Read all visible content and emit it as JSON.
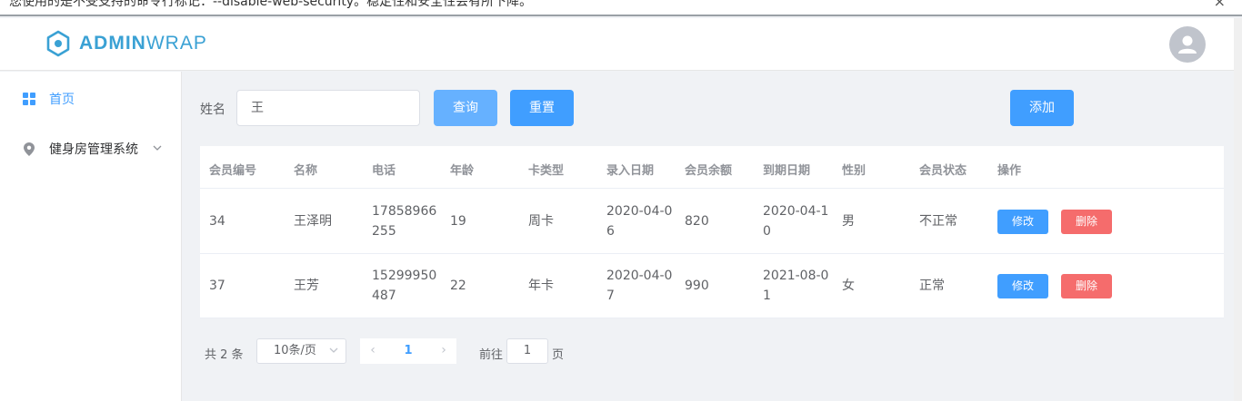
{
  "infobar": {
    "message": "您使用的是不受支持的命令行标记：--disable-web-security。稳定性和安全性会有所下降。",
    "close_glyph": "×"
  },
  "header": {
    "logo_bold": "ADMIN",
    "logo_light": "WRAP",
    "brand_color": "#3aa1d4"
  },
  "sidebar": {
    "items": [
      {
        "label": "首页",
        "icon": "grid-icon",
        "active": true
      },
      {
        "label": "健身房管理系统",
        "icon": "location-pin-icon",
        "expandable": true
      }
    ]
  },
  "filter": {
    "name_label": "姓名",
    "name_value": "王",
    "query_label": "查询",
    "reset_label": "重置",
    "add_label": "添加"
  },
  "table": {
    "columns": [
      "会员编号",
      "名称",
      "电话",
      "年龄",
      "卡类型",
      "录入日期",
      "会员余额",
      "到期日期",
      "性别",
      "会员状态",
      "操作"
    ],
    "rows": [
      {
        "id": "34",
        "name": "王泽明",
        "phone": "17858966255",
        "age": "19",
        "card": "周卡",
        "entry": "2020-04-06",
        "balance": "820",
        "expire": "2020-04-10",
        "gender": "男",
        "status": "不正常"
      },
      {
        "id": "37",
        "name": "王芳",
        "phone": "15299950487",
        "age": "22",
        "card": "年卡",
        "entry": "2020-04-07",
        "balance": "990",
        "expire": "2021-08-01",
        "gender": "女",
        "status": "正常"
      }
    ],
    "edit_label": "修改",
    "delete_label": "删除"
  },
  "pagination": {
    "total_text": "共 2 条",
    "page_size": "10条/页",
    "current_page": "1",
    "prev_glyph": "‹",
    "next_glyph": "›",
    "goto_label": "前往",
    "goto_value": "1",
    "goto_suffix": "页"
  },
  "colors": {
    "primary": "#409eff",
    "primary_light": "#66b1ff",
    "danger": "#f56c6c"
  }
}
